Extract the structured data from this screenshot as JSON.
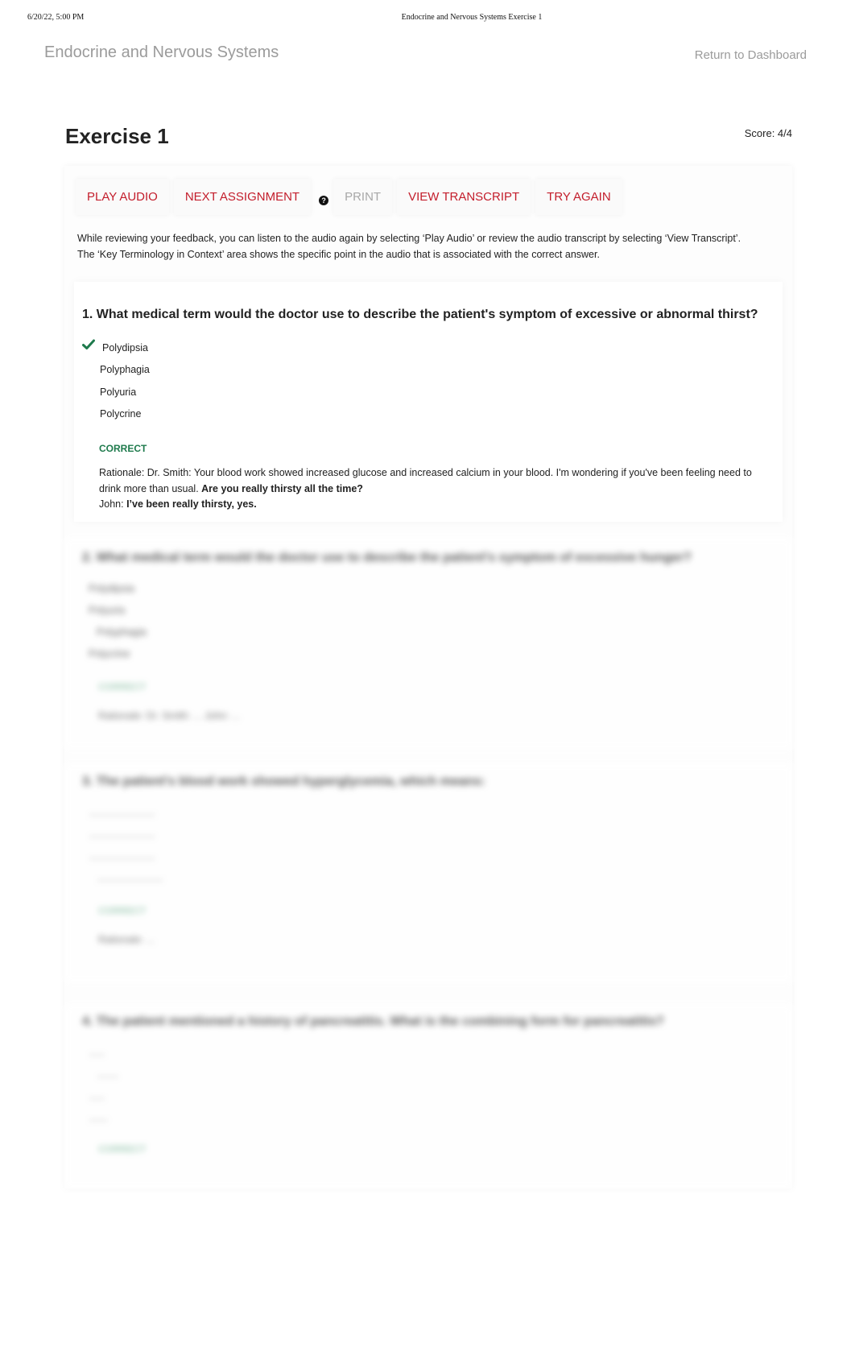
{
  "print_header": {
    "datetime": "6/20/22, 5:00 PM",
    "page_title": "Endocrine and Nervous Systems Exercise 1"
  },
  "header": {
    "app_title": "Endocrine and Nervous Systems",
    "return_link": "Return to Dashboard"
  },
  "exercise": {
    "title": "Exercise 1",
    "score": "Score: 4/4"
  },
  "toolbar": {
    "play_audio": "PLAY AUDIO",
    "next_assignment": "NEXT ASSIGNMENT",
    "help_icon": "?",
    "print": "PRINT",
    "view_transcript": "VIEW TRANSCRIPT",
    "try_again": "TRY AGAIN"
  },
  "intro": {
    "line1": "While reviewing your feedback, you can listen to the audio again by selecting ‘Play Audio’ or review the audio transcript by selecting ‘View Transcript’.",
    "line2": "The ‘Key Terminology in Context’ area shows the specific point in the audio that is associated with the correct answer."
  },
  "colors": {
    "accent_red": "#c31d2b",
    "correct_green": "#1e7a4c",
    "muted_gray": "#9b9b9b"
  },
  "questions": [
    {
      "title": "1. What medical term would the doctor use to describe the patient's symptom of excessive or abnormal thirst?",
      "options": [
        {
          "label": "Polydipsia",
          "selected": true,
          "icon": "check-icon"
        },
        {
          "label": "Polyphagia"
        },
        {
          "label": "Polyuria"
        },
        {
          "label": "Polycrine"
        }
      ],
      "result": "CORRECT",
      "rationale": {
        "prefix": "Rationale: Dr. Smith: Your blood work showed increased glucose and increased calcium in your blood. I'm wondering if you've been feeling need to drink more than usual. ",
        "bold1": "Are you really thirsty all the time?",
        "speaker2": "John: ",
        "bold2": "I’ve been really thirsty, yes."
      }
    }
  ],
  "blurred_questions": [
    {
      "title": "2. What medical term would the doctor use to describe the patient's symptom of excessive hunger?",
      "options": [
        "Polydipsia",
        "Polyuria",
        "Polyphagia",
        "Polycrine"
      ],
      "result": "CORRECT",
      "rationale": "Rationale: Dr. Smith: ... John: ..."
    },
    {
      "title": "3. The patient's blood work showed hyperglycemia, which means:",
      "options": [
        "........................",
        "........................",
        "........................",
        "........................"
      ],
      "result": "CORRECT",
      "rationale": "Rationale: ..."
    },
    {
      "title": "4. The patient mentioned a history of pancreatitis. What is the combining form for pancreatitis?",
      "options": [
        "......",
        "........",
        "......",
        "......."
      ],
      "result": "CORRECT"
    }
  ]
}
